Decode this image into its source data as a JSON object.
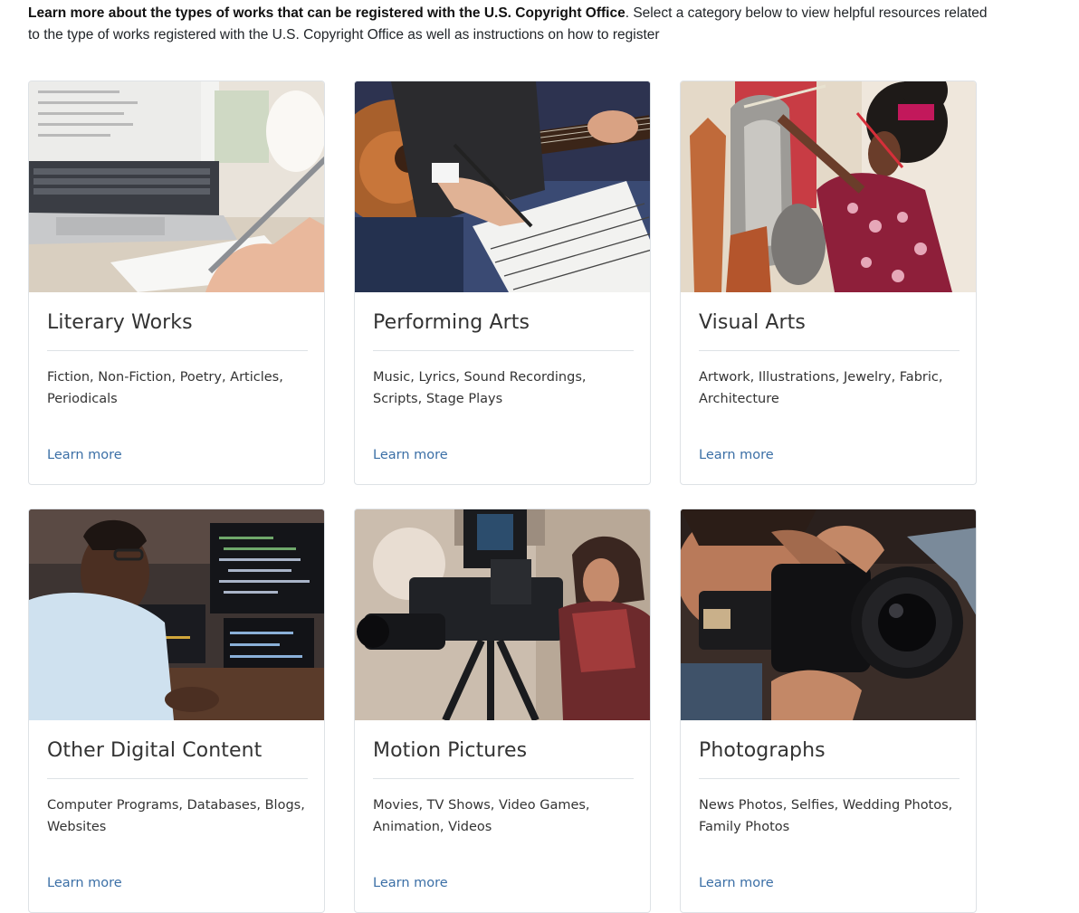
{
  "intro": {
    "bold": "Learn more about the types of works that can be registered with the U.S. Copyright Office",
    "rest": ". Select a category below to view helpful resources related to the type of works registered with the U.S. Copyright Office as well as instructions on how to register"
  },
  "cards": [
    {
      "title": "Literary Works",
      "desc": "Fiction, Non-Fiction, Poetry, Articles, Periodicals",
      "link": "Learn more",
      "image": "laptop-writing-photo"
    },
    {
      "title": "Performing Arts",
      "desc": "Music, Lyrics, Sound Recordings, Scripts, Stage Plays",
      "link": "Learn more",
      "image": "guitar-sheet-music-photo"
    },
    {
      "title": "Visual Arts",
      "desc": "Artwork, Illustrations, Jewelry, Fabric, Architecture",
      "link": "Learn more",
      "image": "painter-canvas-photo"
    },
    {
      "title": "Other Digital Content",
      "desc": "Computer Programs, Databases, Blogs, Websites",
      "link": "Learn more",
      "image": "programmer-laptops-photo"
    },
    {
      "title": "Motion Pictures",
      "desc": "Movies, TV Shows, Video Games, Animation, Videos",
      "link": "Learn more",
      "image": "film-camera-photo"
    },
    {
      "title": "Photographs",
      "desc": "News Photos, Selfies, Wedding Photos, Family Photos",
      "link": "Learn more",
      "image": "photographer-camera-photo"
    }
  ]
}
